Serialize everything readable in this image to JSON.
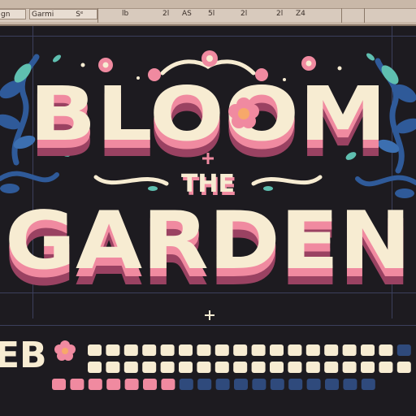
{
  "toolbar": {
    "field_1": "gn",
    "field_2": "Garmi",
    "field_2_suffix": "Sᵉ",
    "numbers": [
      "lb",
      "2l",
      "AS",
      "5l",
      "2l",
      "2l",
      "Z4"
    ]
  },
  "artwork": {
    "title_line_1": "BLOOM",
    "title_line_2": "THE",
    "title_line_3": "GARDEN",
    "glyph_row_label": "EB"
  },
  "colors": {
    "cream": "#f7ecd2",
    "pink": "#f08aa0",
    "shadow": "#9a4262",
    "navy": "#2f4a7c",
    "teal": "#5fbfb0",
    "blue_leaf": "#2f5a99",
    "background": "#1d1b20"
  },
  "glyph_grid": {
    "row_1": [
      "cream",
      "cream",
      "cream",
      "cream",
      "cream",
      "cream",
      "cream",
      "cream",
      "cream",
      "cream",
      "cream",
      "cream",
      "cream",
      "cream",
      "cream",
      "cream",
      "cream",
      "navy"
    ],
    "row_2": [
      "cream",
      "cream",
      "cream",
      "cream",
      "cream",
      "cream",
      "cream",
      "cream",
      "cream",
      "cream",
      "cream",
      "cream",
      "cream",
      "cream",
      "cream",
      "cream",
      "cream",
      "cream"
    ],
    "row_3": [
      "pink",
      "pink",
      "pink",
      "pink",
      "pink",
      "pink",
      "pink",
      "navy",
      "navy",
      "navy",
      "navy",
      "navy",
      "navy",
      "navy",
      "navy",
      "navy",
      "navy",
      "navy"
    ]
  }
}
